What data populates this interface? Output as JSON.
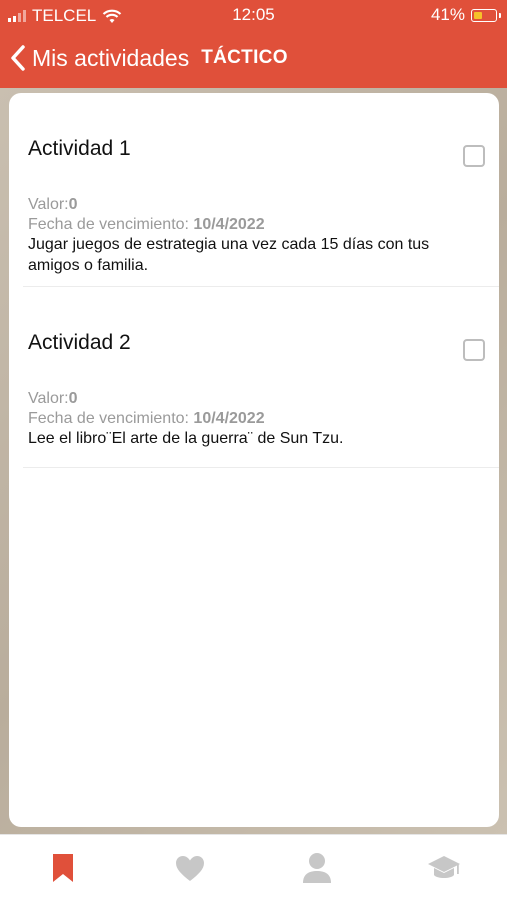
{
  "status": {
    "carrier": "TELCEL",
    "time": "12:05",
    "battery": "41%",
    "battery_level": 0.41
  },
  "nav": {
    "back_label": "Mis actividades",
    "title": "TÁCTICO"
  },
  "activities": [
    {
      "title": "Actividad 1",
      "valor_label": "Valor:",
      "valor": "0",
      "fecha_label": "Fecha de vencimiento: ",
      "fecha": "10/4/2022",
      "description": "Jugar juegos de estrategia una vez cada 15 días con tus amigos o familia."
    },
    {
      "title": "Actividad 2",
      "valor_label": "Valor:",
      "valor": "0",
      "fecha_label": "Fecha de vencimiento: ",
      "fecha": "10/4/2022",
      "description": "Lee el libro¨El arte de la guerra¨ de Sun Tzu."
    }
  ],
  "tabs": [
    {
      "icon": "bookmark-icon",
      "active": true
    },
    {
      "icon": "heart-icon",
      "active": false
    },
    {
      "icon": "user-icon",
      "active": false
    },
    {
      "icon": "graduation-cap-icon",
      "active": false
    }
  ],
  "colors": {
    "accent": "#e0503a",
    "inactive": "#c7c7c7"
  }
}
